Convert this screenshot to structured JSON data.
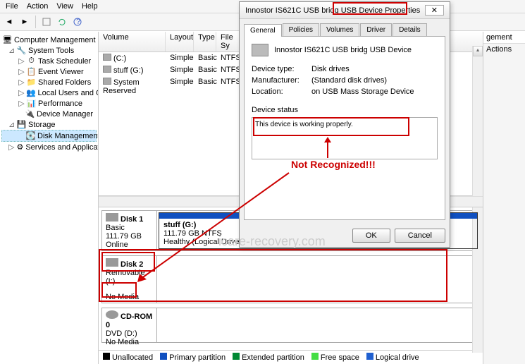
{
  "menu": {
    "file": "File",
    "action": "Action",
    "view": "View",
    "help": "Help"
  },
  "tree": {
    "root": "Computer Management (Local",
    "system_tools": "System Tools",
    "task_scheduler": "Task Scheduler",
    "event_viewer": "Event Viewer",
    "shared_folders": "Shared Folders",
    "local_users": "Local Users and Groups",
    "performance": "Performance",
    "device_manager": "Device Manager",
    "storage": "Storage",
    "disk_management": "Disk Management",
    "services": "Services and Applications"
  },
  "vol_head": {
    "volume": "Volume",
    "layout": "Layout",
    "type": "Type",
    "fs": "File Sy"
  },
  "volumes": [
    {
      "name": "(C:)",
      "layout": "Simple",
      "type": "Basic",
      "fs": "NTFS"
    },
    {
      "name": "stuff (G:)",
      "layout": "Simple",
      "type": "Basic",
      "fs": "NTFS"
    },
    {
      "name": "System Reserved",
      "layout": "Simple",
      "type": "Basic",
      "fs": "NTFS"
    }
  ],
  "disk1": {
    "name": "Disk 1",
    "type": "Basic",
    "size": "111.79 GB",
    "status": "Online",
    "vol_name": "stuff  (G:)",
    "vol_size": "111.79 GB NTFS",
    "vol_status": "Healthy (Logical Drive"
  },
  "disk2": {
    "name": "Disk 2",
    "type": "Removable (I:)",
    "status": "No Media"
  },
  "cdrom": {
    "name": "CD-ROM 0",
    "type": "DVD (D:)",
    "status": "No Media"
  },
  "legend": {
    "unalloc": "Unallocated",
    "primary": "Primary partition",
    "extended": "Extended partition",
    "free": "Free space",
    "logical": "Logical drive"
  },
  "right": {
    "management": "gement",
    "actions": "Actions"
  },
  "dialog": {
    "title_prefix": "Innostor IS621C USB bridg USB",
    "title_suffix": "Device Properties",
    "tabs": {
      "general": "General",
      "policies": "Policies",
      "volumes": "Volumes",
      "driver": "Driver",
      "details": "Details"
    },
    "device_name": "Innostor IS621C USB bridg USB Device",
    "device_type_label": "Device type:",
    "device_type_value": "Disk drives",
    "manufacturer_label": "Manufacturer:",
    "manufacturer_value": "(Standard disk drives)",
    "location_label": "Location:",
    "location_value": "on USB Mass Storage Device",
    "status_label": "Device status",
    "status_text": "This device is working properly.",
    "ok": "OK",
    "cancel": "Cancel"
  },
  "annotation": {
    "not_recognized": "Not Recognized!!!"
  },
  "watermark": "icare-recovery.com",
  "scroll_marker": "III"
}
